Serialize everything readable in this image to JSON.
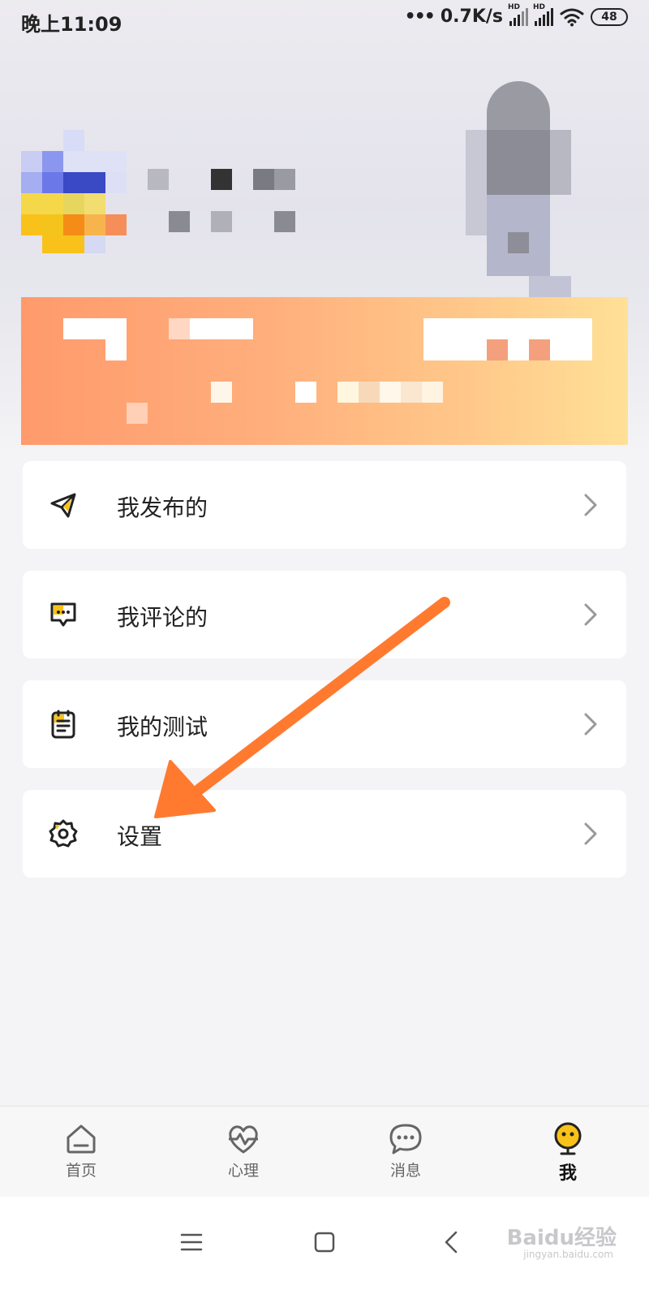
{
  "status_bar": {
    "time": "晚上11:09",
    "network_speed": "0.7K/s",
    "signal_badge": "HD",
    "battery": "48"
  },
  "menu": [
    {
      "label": "我发布的",
      "icon": "paper-plane-icon"
    },
    {
      "label": "我评论的",
      "icon": "comment-icon"
    },
    {
      "label": "我的测试",
      "icon": "clipboard-icon"
    },
    {
      "label": "设置",
      "icon": "gear-icon"
    }
  ],
  "tabs": [
    {
      "label": "首页",
      "icon": "home-icon",
      "active": false
    },
    {
      "label": "心理",
      "icon": "heart-pulse-icon",
      "active": false
    },
    {
      "label": "消息",
      "icon": "chat-bubble-icon",
      "active": false
    },
    {
      "label": "我",
      "icon": "smiley-face-icon",
      "active": true
    }
  ],
  "watermark": {
    "text": "Baidu经验",
    "sub": "jingyan.baidu.com"
  },
  "colors": {
    "accent_yellow": "#f9c21a",
    "annotation_arrow": "#ff7a2f",
    "banner_start": "#ff9a6c",
    "banner_end": "#ffe096"
  }
}
